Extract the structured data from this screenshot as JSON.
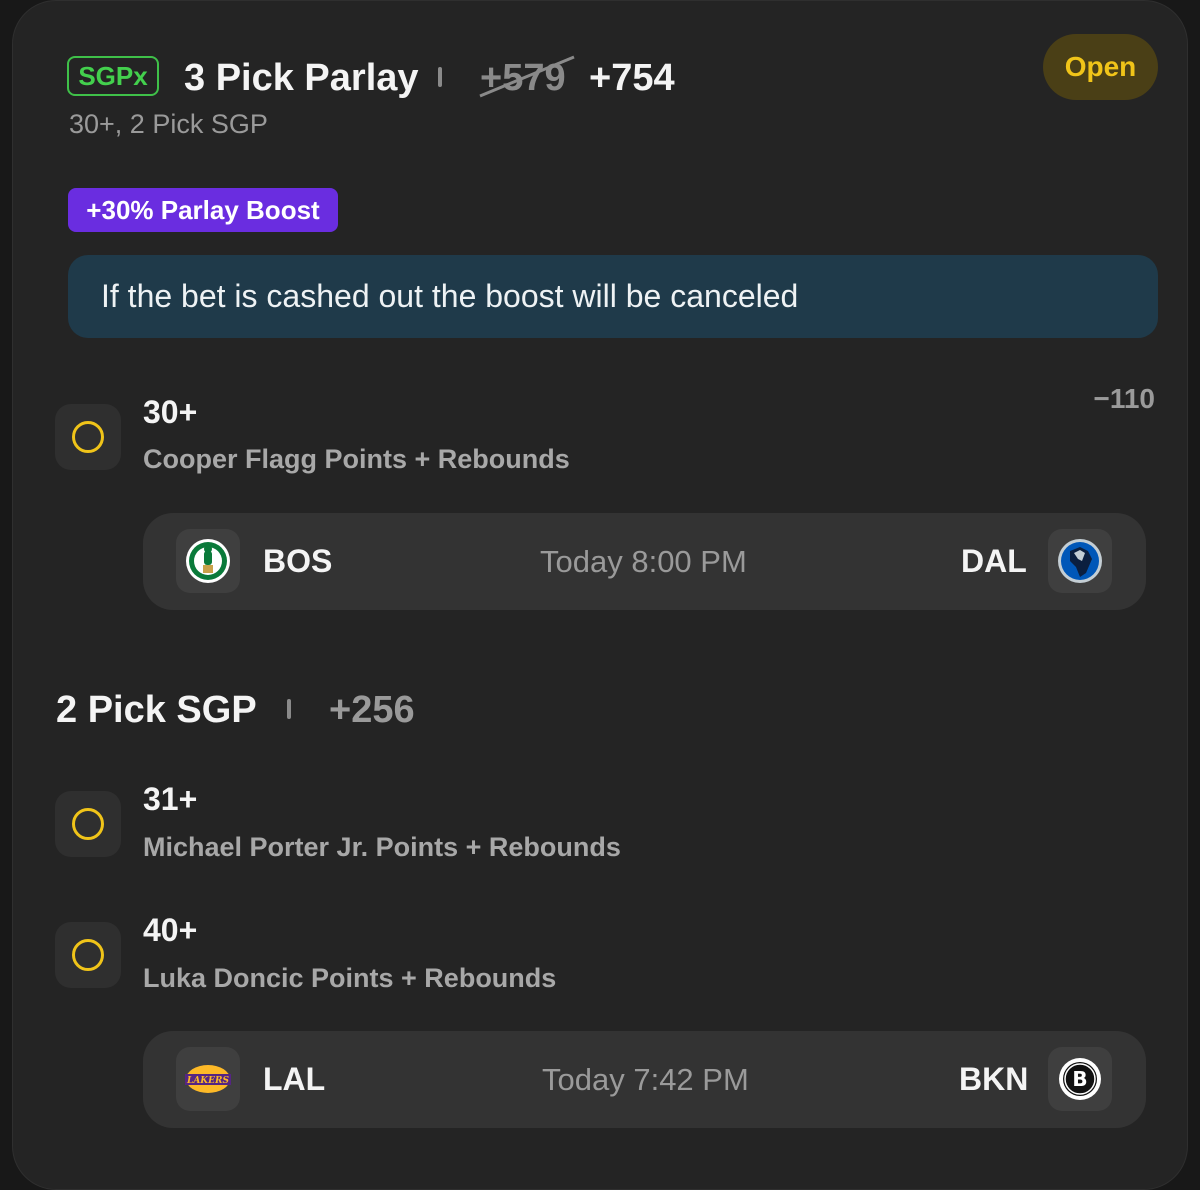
{
  "header": {
    "badge": "SGPx",
    "title": "3 Pick Parlay",
    "old_odds": "+579",
    "new_odds": "+754",
    "subtitle": "30+, 2 Pick SGP",
    "status": "Open"
  },
  "boost": {
    "label": "+30% Parlay Boost",
    "notice": "If the bet is cashed out the boost will be canceled"
  },
  "picks": [
    {
      "line": "30+",
      "market": "Cooper Flagg Points + Rebounds",
      "odds": "−110"
    },
    {
      "line": "31+",
      "market": "Michael Porter Jr. Points + Rebounds"
    },
    {
      "line": "40+",
      "market": "Luka Doncic Points + Rebounds"
    }
  ],
  "games": [
    {
      "home": "BOS",
      "time": "Today 8:00 PM",
      "away": "DAL",
      "home_logo": "celtics-logo-icon",
      "away_logo": "mavericks-logo-icon"
    },
    {
      "home": "LAL",
      "time": "Today 7:42 PM",
      "away": "BKN",
      "home_logo": "lakers-logo-icon",
      "away_logo": "nets-logo-icon"
    }
  ],
  "sgp": {
    "title": "2 Pick SGP",
    "odds": "+256"
  },
  "colors": {
    "background": "#242424",
    "sgpx_green": "#43d04d",
    "open_yellow": "#f0c419",
    "boost_purple": "#6a2de0",
    "notice_blue": "#1f3a4a"
  }
}
